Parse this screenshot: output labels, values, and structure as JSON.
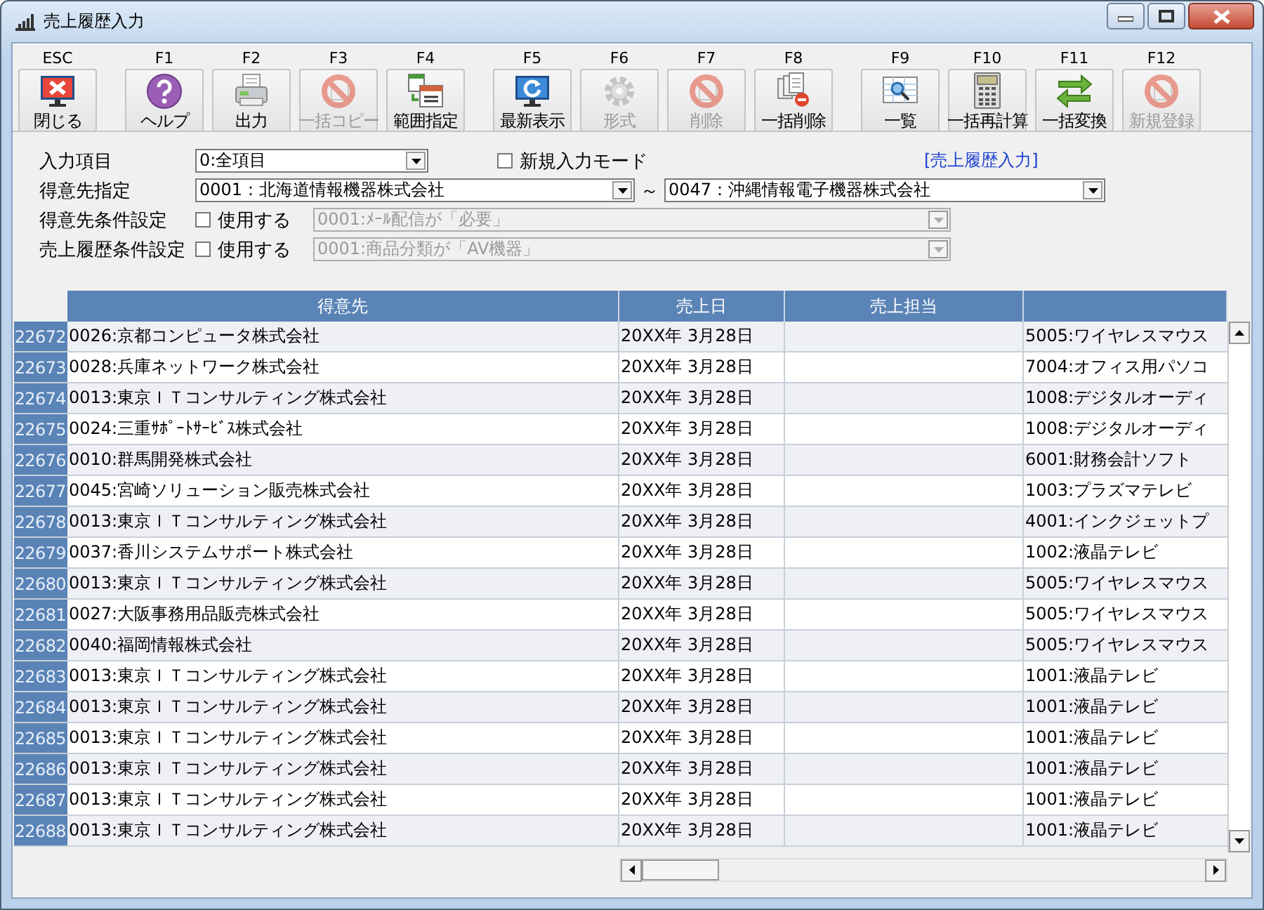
{
  "window": {
    "title": "売上履歴入力"
  },
  "toolbar": [
    {
      "key": "ESC",
      "label": "閉じる",
      "disabled": false
    },
    {
      "key": "F1",
      "label": "ヘルプ",
      "disabled": false
    },
    {
      "key": "F2",
      "label": "出力",
      "disabled": false
    },
    {
      "key": "F3",
      "label": "一括コピー",
      "disabled": true
    },
    {
      "key": "F4",
      "label": "範囲指定",
      "disabled": false
    },
    {
      "key": "F5",
      "label": "最新表示",
      "disabled": false
    },
    {
      "key": "F6",
      "label": "形式",
      "disabled": true
    },
    {
      "key": "F7",
      "label": "削除",
      "disabled": true
    },
    {
      "key": "F8",
      "label": "一括削除",
      "disabled": false
    },
    {
      "key": "F9",
      "label": "一覧",
      "disabled": false
    },
    {
      "key": "F10",
      "label": "一括再計算",
      "disabled": false
    },
    {
      "key": "F11",
      "label": "一括変換",
      "disabled": false
    },
    {
      "key": "F12",
      "label": "新規登録",
      "disabled": true
    }
  ],
  "form": {
    "input_item": {
      "label": "入力項目",
      "value": "0:全項目"
    },
    "new_mode": {
      "label": "新規入力モード",
      "checked": false
    },
    "screen_name": "[売上履歴入力]",
    "customer_range": {
      "label": "得意先指定",
      "from": "0001：北海道情報機器株式会社",
      "separator": "～",
      "to": "0047：沖縄情報電子機器株式会社"
    },
    "conditions": [
      {
        "label": "得意先条件設定",
        "checkbox_label": "使用する",
        "checked": false,
        "value": "0001:ﾒｰﾙ配信が「必要」",
        "disabled": true
      },
      {
        "label": "売上履歴条件設定",
        "checkbox_label": "使用する",
        "checked": false,
        "value": "0001:商品分類が「AV機器」",
        "disabled": true
      }
    ]
  },
  "table": {
    "columns": [
      "得意先",
      "売上日",
      "売上担当"
    ],
    "rows": [
      {
        "no": "22672",
        "customer": "0026:京都コンピュータ株式会社",
        "date": "20XX年 3月28日",
        "column_4": "5005:ワイヤレスマウス"
      },
      {
        "no": "22673",
        "customer": "0028:兵庫ネットワーク株式会社",
        "date": "20XX年 3月28日",
        "column_4": "7004:オフィス用パソコ"
      },
      {
        "no": "22674",
        "customer": "0013:東京ＩＴコンサルティング株式会社",
        "date": "20XX年 3月28日",
        "column_4": "1008:デジタルオーディ"
      },
      {
        "no": "22675",
        "customer": "0024:三重ｻﾎﾟｰﾄｻｰﾋﾞｽ株式会社",
        "date": "20XX年 3月28日",
        "column_4": "1008:デジタルオーディ"
      },
      {
        "no": "22676",
        "customer": "0010:群馬開発株式会社",
        "date": "20XX年 3月28日",
        "column_4": "6001:財務会計ソフト"
      },
      {
        "no": "22677",
        "customer": "0045:宮崎ソリューション販売株式会社",
        "date": "20XX年 3月28日",
        "column_4": "1003:プラズマテレビ"
      },
      {
        "no": "22678",
        "customer": "0013:東京ＩＴコンサルティング株式会社",
        "date": "20XX年 3月28日",
        "column_4": "4001:インクジェットプ"
      },
      {
        "no": "22679",
        "customer": "0037:香川システムサポート株式会社",
        "date": "20XX年 3月28日",
        "column_4": "1002:液晶テレビ"
      },
      {
        "no": "22680",
        "customer": "0013:東京ＩＴコンサルティング株式会社",
        "date": "20XX年 3月28日",
        "column_4": "5005:ワイヤレスマウス"
      },
      {
        "no": "22681",
        "customer": "0027:大阪事務用品販売株式会社",
        "date": "20XX年 3月28日",
        "column_4": "5005:ワイヤレスマウス"
      },
      {
        "no": "22682",
        "customer": "0040:福岡情報株式会社",
        "date": "20XX年 3月28日",
        "column_4": "5005:ワイヤレスマウス"
      },
      {
        "no": "22683",
        "customer": "0013:東京ＩＴコンサルティング株式会社",
        "date": "20XX年 3月28日",
        "column_4": "1001:液晶テレビ"
      },
      {
        "no": "22684",
        "customer": "0013:東京ＩＴコンサルティング株式会社",
        "date": "20XX年 3月28日",
        "column_4": "1001:液晶テレビ"
      },
      {
        "no": "22685",
        "customer": "0013:東京ＩＴコンサルティング株式会社",
        "date": "20XX年 3月28日",
        "column_4": "1001:液晶テレビ"
      },
      {
        "no": "22686",
        "customer": "0013:東京ＩＴコンサルティング株式会社",
        "date": "20XX年 3月28日",
        "column_4": "1001:液晶テレビ"
      },
      {
        "no": "22687",
        "customer": "0013:東京ＩＴコンサルティング株式会社",
        "date": "20XX年 3月28日",
        "column_4": "1001:液晶テレビ"
      },
      {
        "no": "22688",
        "customer": "0013:東京ＩＴコンサルティング株式会社",
        "date": "20XX年 3月28日",
        "column_4": "1001:液晶テレビ"
      }
    ]
  }
}
